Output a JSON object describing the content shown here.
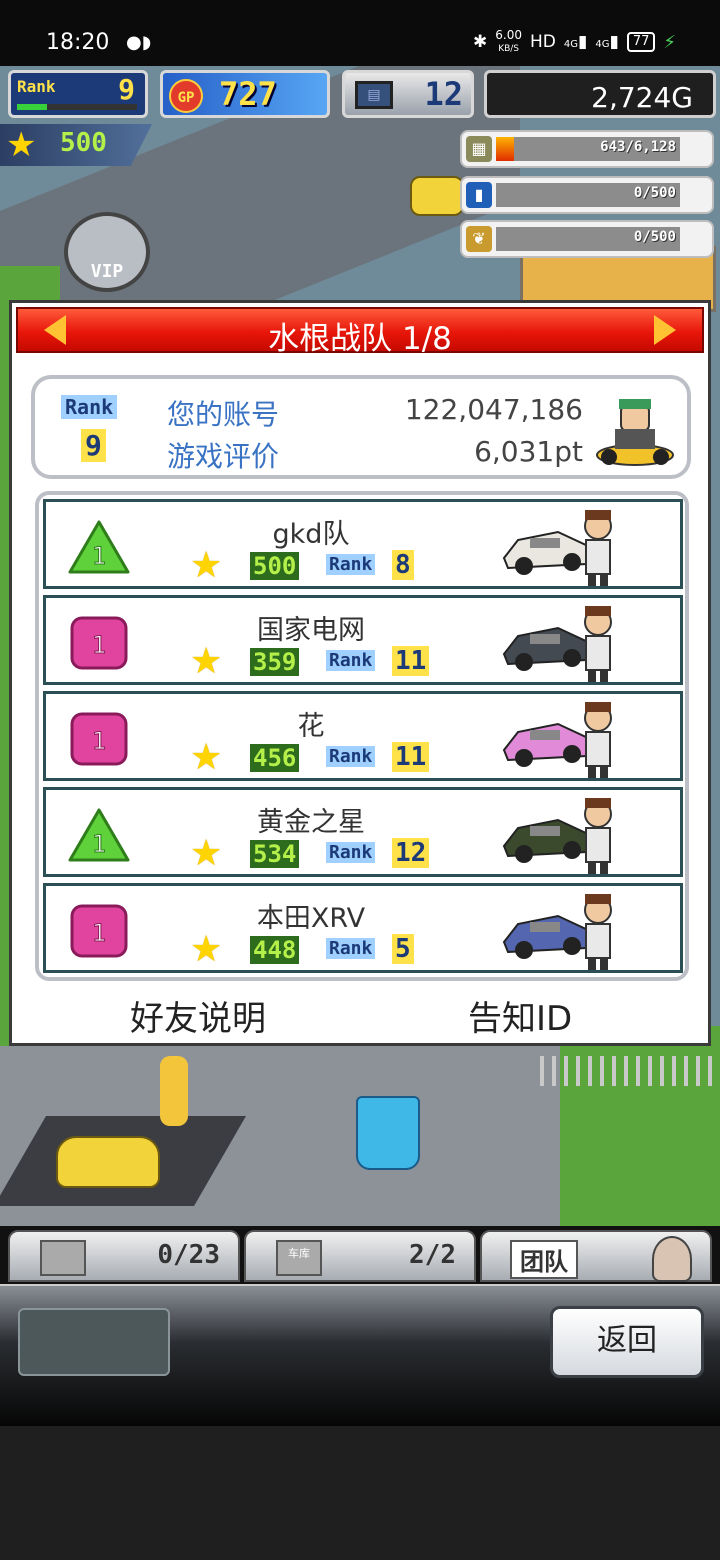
{
  "status_bar": {
    "time": "18:20",
    "net_speed": "6.00",
    "net_unit": "KB/S",
    "hd": "HD",
    "signal1": "4G",
    "signal2": "4G",
    "battery": "77"
  },
  "hud": {
    "rank_label": "Rank",
    "rank_value": "9",
    "rank_progress": 0.25,
    "gp_label": "GP",
    "gp_value": "727",
    "pc_value": "12",
    "money": "2,724G",
    "star_value": "500"
  },
  "resources": [
    {
      "icon": "coins-icon",
      "value": "643/6,128",
      "fill": 0.1
    },
    {
      "icon": "bottle-icon",
      "value": "0/500",
      "fill": 0
    },
    {
      "icon": "wheat-icon",
      "value": "0/500",
      "fill": 0
    }
  ],
  "vip_label": "VIP",
  "dialog": {
    "title": "水根战队 1/8",
    "me": {
      "rank_label": "Rank",
      "rank_value": "9",
      "account_label": "您的账号",
      "account_value": "122,047,186",
      "rating_label": "游戏评价",
      "rating_value": "6,031pt"
    },
    "friends": [
      {
        "name": "gkd队",
        "stars": "500",
        "rank_label": "Rank",
        "rank": "8",
        "badge": "1",
        "badge_color": "green",
        "car_color": "#e9e7df"
      },
      {
        "name": "国家电网",
        "stars": "359",
        "rank_label": "Rank",
        "rank": "11",
        "badge": "1",
        "badge_color": "pink",
        "car_color": "#444a52"
      },
      {
        "name": "花",
        "stars": "456",
        "rank_label": "Rank",
        "rank": "11",
        "badge": "1",
        "badge_color": "pink",
        "car_color": "#e08ad8"
      },
      {
        "name": "黄金之星",
        "stars": "534",
        "rank_label": "Rank",
        "rank": "12",
        "badge": "1",
        "badge_color": "green",
        "car_color": "#3b4a2c"
      },
      {
        "name": "本田XRV",
        "stars": "448",
        "rank_label": "Rank",
        "rank": "5",
        "badge": "1",
        "badge_color": "pink",
        "car_color": "#5566b0"
      }
    ],
    "footer": {
      "friend_help": "好友说明",
      "notify_id": "告知ID"
    }
  },
  "tabs": [
    {
      "icon": "box-icon",
      "text": "0/23"
    },
    {
      "icon": "garage-icon",
      "icon_label": "车库",
      "text": "2/2"
    },
    {
      "icon": "team-icon",
      "text": "团队"
    }
  ],
  "back_label": "返回",
  "colors": {
    "header_red": "#e8160a",
    "arrow_yellow": "#ffc233",
    "label_blue": "#3a73c4",
    "badge_green": "#5ed13b",
    "badge_pink": "#e0449e"
  }
}
